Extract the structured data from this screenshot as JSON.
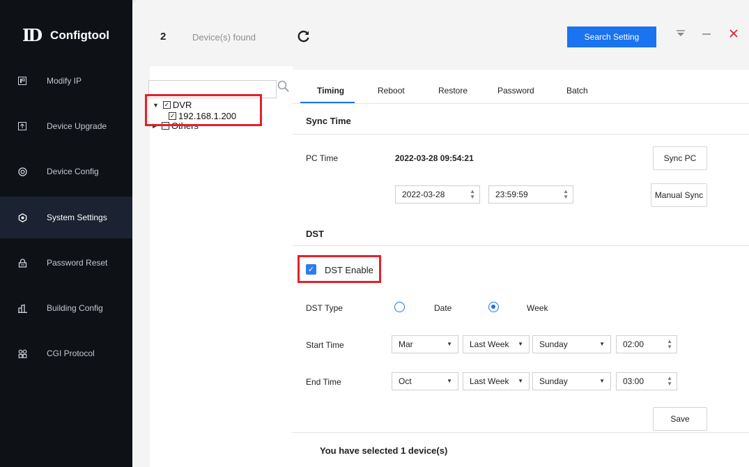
{
  "app": {
    "name": "Configtool",
    "logo_mark": "ID"
  },
  "sidebar": {
    "items": [
      {
        "label": "Modify IP",
        "icon": "ip-icon"
      },
      {
        "label": "Device Upgrade",
        "icon": "upgrade-icon"
      },
      {
        "label": "Device Config",
        "icon": "config-icon"
      },
      {
        "label": "System Settings",
        "icon": "settings-icon",
        "active": true
      },
      {
        "label": "Password Reset",
        "icon": "lock-icon"
      },
      {
        "label": "Building Config",
        "icon": "building-icon"
      },
      {
        "label": "CGI Protocol",
        "icon": "cgi-icon"
      }
    ]
  },
  "topbar": {
    "device_count": "2",
    "devices_found_label": "Device(s) found",
    "search_setting_label": "Search Setting"
  },
  "tree": {
    "search_placeholder": "",
    "root_label": "DVR",
    "child_label": "192.168.1.200",
    "others_label": "Others"
  },
  "tabs": [
    "Timing",
    "Reboot",
    "Restore",
    "Password",
    "Batch"
  ],
  "sync_time": {
    "title": "Sync Time",
    "pc_time_label": "PC Time",
    "pc_time_value": "2022-03-28 09:54:21",
    "sync_pc_label": "Sync PC",
    "date_value": "2022-03-28",
    "time_value": "23:59:59",
    "manual_sync_label": "Manual Sync"
  },
  "dst": {
    "title": "DST",
    "enable_label": "DST Enable",
    "type_label": "DST Type",
    "type_date_label": "Date",
    "type_week_label": "Week",
    "start_label": "Start Time",
    "start_month": "Mar",
    "start_week": "Last Week",
    "start_day": "Sunday",
    "start_time": "02:00",
    "end_label": "End Time",
    "end_month": "Oct",
    "end_week": "Last Week",
    "end_day": "Sunday",
    "end_time": "03:00",
    "save_label": "Save"
  },
  "footer": {
    "selected_text": "You have selected 1 device(s)"
  },
  "colors": {
    "accent": "#1a73f0",
    "sidebar_bg": "#0e1116",
    "highlight_red": "#e3202c"
  }
}
